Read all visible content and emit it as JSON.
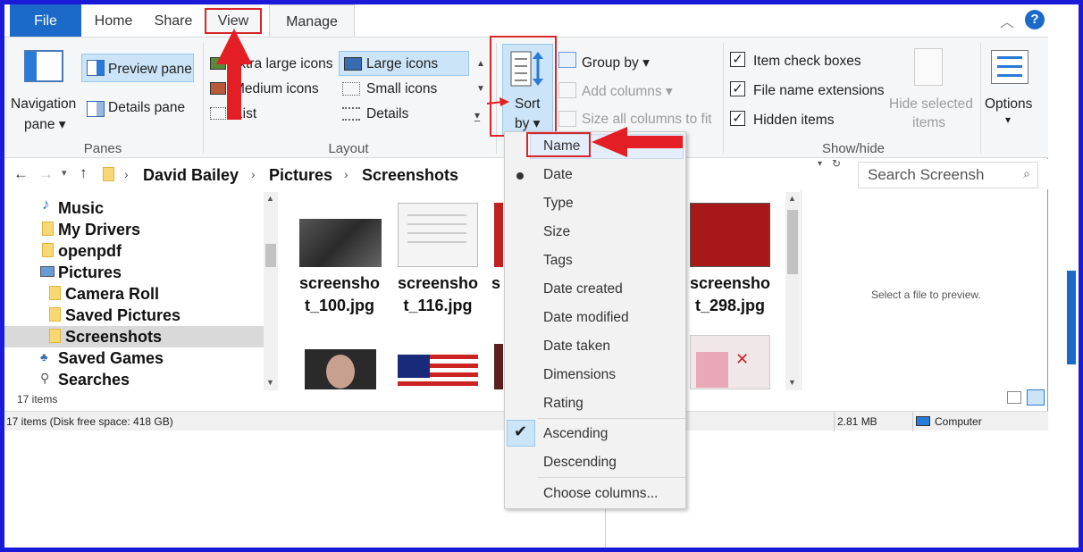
{
  "tabs": {
    "file": "File",
    "home": "Home",
    "share": "Share",
    "view": "View",
    "manage": "Manage"
  },
  "ribbon": {
    "panes": {
      "navigation_pane": "Navigation",
      "navigation_pane2": "pane",
      "preview_pane": "Preview pane",
      "details_pane": "Details pane",
      "group": "Panes"
    },
    "layout": {
      "extra_large": "Extra large icons",
      "large": "Large icons",
      "medium": "Medium icons",
      "small": "Small icons",
      "list": "List",
      "details": "Details",
      "group": "Layout"
    },
    "current_view": {
      "sort_by": "Sort",
      "sort_by2": "by",
      "group_by": "Group by",
      "add_columns": "Add columns",
      "size_all": "Size all columns to fit"
    },
    "show_hide": {
      "item_check_boxes": "Item check boxes",
      "file_name_ext": "File name extensions",
      "hidden_items": "Hidden items",
      "hide_selected": "Hide selected",
      "hide_selected2": "items",
      "group": "Show/hide"
    },
    "options": "Options"
  },
  "breadcrumb": [
    "David Bailey",
    "Pictures",
    "Screenshots"
  ],
  "search": {
    "placeholder": "Search Screensh"
  },
  "nav": {
    "items": [
      "Music",
      "My Drivers",
      "openpdf",
      "Pictures",
      "Camera Roll",
      "Saved Pictures",
      "Screenshots",
      "Saved Games",
      "Searches"
    ]
  },
  "files": [
    {
      "name1": "screensho",
      "name2": "t_100.jpg"
    },
    {
      "name1": "screensho",
      "name2": "t_116.jpg"
    },
    {
      "name1": "s",
      "name2": ""
    },
    {
      "name1": "screensho",
      "name2": "t_298.jpg"
    }
  ],
  "preview": "Select a file to preview.",
  "item_count": "17 items",
  "status": {
    "left": "17 items (Disk free space: 418 GB)",
    "size": "2.81 MB",
    "location": "Computer"
  },
  "menu": {
    "items": [
      "Name",
      "Date",
      "Type",
      "Size",
      "Tags",
      "Date created",
      "Date modified",
      "Date taken",
      "Dimensions",
      "Rating"
    ],
    "order": [
      "Ascending",
      "Descending"
    ],
    "choose": "Choose columns..."
  },
  "colors": {
    "accent": "#1b6ac9",
    "annotation": "#d8262a",
    "frame": "#1a1ad8"
  }
}
